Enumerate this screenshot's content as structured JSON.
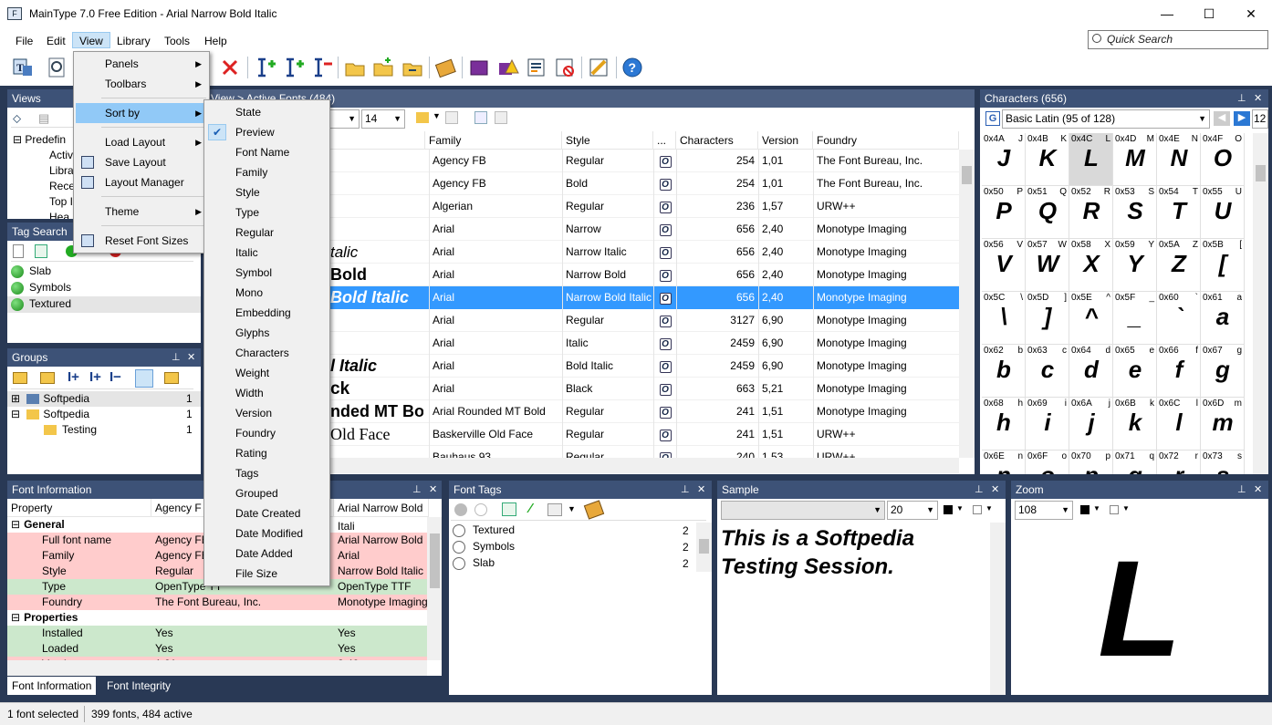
{
  "window": {
    "title": "MainType 7.0 Free Edition - Arial Narrow Bold Italic",
    "minimize": "—",
    "maximize": "☐",
    "close": "✕"
  },
  "menubar": {
    "items": [
      "File",
      "Edit",
      "View",
      "Library",
      "Tools",
      "Help"
    ],
    "active": "View"
  },
  "quick_search": {
    "placeholder": "Quick Search"
  },
  "toolbar": {
    "icons": [
      "new-library-icon",
      "preview-icon",
      "delete-icon",
      "add-fonts-icon",
      "add-folder-icon",
      "remove-fonts-icon",
      "open-folder-icon",
      "new-folder-icon",
      "folder-import-icon",
      "library-icon",
      "purple-book-icon",
      "warning-icon",
      "report-icon",
      "uninstall-icon",
      "print-icon",
      "help-icon"
    ]
  },
  "view_menu": {
    "items": [
      {
        "label": "Panels",
        "submenu": true
      },
      {
        "label": "Toolbars",
        "submenu": true
      },
      {
        "label": "Sort by",
        "submenu": true,
        "highlighted": true
      },
      {
        "label": "Load Layout",
        "submenu": true
      },
      {
        "label": "Save Layout",
        "icon": "save-icon"
      },
      {
        "label": "Layout Manager",
        "icon": "layout-manager-icon"
      },
      {
        "label": "Theme",
        "submenu": true
      },
      {
        "label": "Reset Font Sizes",
        "icon": "reset-font-sizes-icon"
      }
    ]
  },
  "sort_menu": {
    "items": [
      "State",
      "Preview",
      "Font Name",
      "Family",
      "Style",
      "Type",
      "Regular",
      "Italic",
      "Symbol",
      "Mono",
      "Embedding",
      "Glyphs",
      "Characters",
      "Weight",
      "Width",
      "Version",
      "Foundry",
      "Rating",
      "Tags",
      "Grouped",
      "Date Created",
      "Date Modified",
      "Date Added",
      "File Size"
    ],
    "checked": "Preview"
  },
  "views_panel": {
    "title": "Views",
    "tree": [
      "Predefin",
      "Activ",
      "Libra",
      "Rece",
      "Top I",
      "Hea"
    ]
  },
  "tag_search_panel": {
    "title": "Tag Search",
    "items": [
      "Slab",
      "Symbols",
      "Textured"
    ]
  },
  "groups_panel": {
    "title": "Groups",
    "items": [
      {
        "label": "Softpedia",
        "count": "1"
      },
      {
        "label": "Softpedia",
        "count": "1"
      },
      {
        "label": "Testing",
        "count": "1"
      }
    ]
  },
  "font_list": {
    "header": "View > Active Fonts (484)",
    "size": "14",
    "columns": [
      "Family",
      "Style",
      "...",
      "Characters",
      "Version",
      "Foundry"
    ],
    "rows": [
      {
        "preview": "",
        "family": "Agency FB",
        "style": "Regular",
        "chars": "254",
        "version": "1,01",
        "foundry": "The Font Bureau, Inc."
      },
      {
        "preview": "",
        "family": "Agency FB",
        "style": "Bold",
        "chars": "254",
        "version": "1,01",
        "foundry": "The Font Bureau, Inc."
      },
      {
        "preview": "",
        "family": "Algerian",
        "style": "Regular",
        "chars": "236",
        "version": "1,57",
        "foundry": "URW++"
      },
      {
        "preview": "",
        "family": "Arial",
        "style": "Narrow",
        "chars": "656",
        "version": "2,40",
        "foundry": "Monotype Imaging"
      },
      {
        "preview": "talic",
        "family": "Arial",
        "style": "Narrow Italic",
        "chars": "656",
        "version": "2,40",
        "foundry": "Monotype Imaging"
      },
      {
        "preview": "Bold",
        "family": "Arial",
        "style": "Narrow Bold",
        "chars": "656",
        "version": "2,40",
        "foundry": "Monotype Imaging"
      },
      {
        "preview": "Bold Italic",
        "family": "Arial",
        "style": "Narrow Bold Italic",
        "chars": "656",
        "version": "2,40",
        "foundry": "Monotype Imaging",
        "selected": true
      },
      {
        "preview": "",
        "family": "Arial",
        "style": "Regular",
        "chars": "3127",
        "version": "6,90",
        "foundry": "Monotype Imaging"
      },
      {
        "preview": "",
        "family": "Arial",
        "style": "Italic",
        "chars": "2459",
        "version": "6,90",
        "foundry": "Monotype Imaging"
      },
      {
        "preview": "l Italic",
        "family": "Arial",
        "style": "Bold Italic",
        "chars": "2459",
        "version": "6,90",
        "foundry": "Monotype Imaging"
      },
      {
        "preview": "ck",
        "family": "Arial",
        "style": "Black",
        "chars": "663",
        "version": "5,21",
        "foundry": "Monotype Imaging"
      },
      {
        "preview": "nded MT Bo",
        "family": "Arial Rounded MT Bold",
        "style": "Regular",
        "chars": "241",
        "version": "1,51",
        "foundry": "Monotype Imaging"
      },
      {
        "preview": "Old Face",
        "family": "Baskerville Old Face",
        "style": "Regular",
        "chars": "241",
        "version": "1,51",
        "foundry": "URW++"
      },
      {
        "preview": "",
        "family": "Bauhaus 93",
        "style": "Regular",
        "chars": "240",
        "version": "1,53",
        "foundry": "URW++"
      }
    ]
  },
  "characters_panel": {
    "title": "Characters (656)",
    "range": "Basic Latin (95 of 128)",
    "zoom": "12",
    "cells": [
      [
        "0x4A",
        "J"
      ],
      [
        "0x4B",
        "K"
      ],
      [
        "0x4C",
        "L"
      ],
      [
        "0x4D",
        "M"
      ],
      [
        "0x4E",
        "N"
      ],
      [
        "0x4F",
        "O"
      ],
      [
        "0x50",
        "P"
      ],
      [
        "0x51",
        "Q"
      ],
      [
        "0x52",
        "R"
      ],
      [
        "0x53",
        "S"
      ],
      [
        "0x54",
        "T"
      ],
      [
        "0x55",
        "U"
      ],
      [
        "0x56",
        "V"
      ],
      [
        "0x57",
        "W"
      ],
      [
        "0x58",
        "X"
      ],
      [
        "0x59",
        "Y"
      ],
      [
        "0x5A",
        "Z"
      ],
      [
        "0x5B",
        "["
      ],
      [
        "0x5C",
        "\\"
      ],
      [
        "0x5D",
        "]"
      ],
      [
        "0x5E",
        "^"
      ],
      [
        "0x5F",
        "_"
      ],
      [
        "0x60",
        "`"
      ],
      [
        "0x61",
        "a"
      ],
      [
        "0x62",
        "b"
      ],
      [
        "0x63",
        "c"
      ],
      [
        "0x64",
        "d"
      ],
      [
        "0x65",
        "e"
      ],
      [
        "0x66",
        "f"
      ],
      [
        "0x67",
        "g"
      ],
      [
        "0x68",
        "h"
      ],
      [
        "0x69",
        "i"
      ],
      [
        "0x6A",
        "j"
      ],
      [
        "0x6B",
        "k"
      ],
      [
        "0x6C",
        "l"
      ],
      [
        "0x6D",
        "m"
      ],
      [
        "0x6E",
        "n"
      ],
      [
        "0x6F",
        "o"
      ],
      [
        "0x70",
        "p"
      ],
      [
        "0x71",
        "q"
      ],
      [
        "0x72",
        "r"
      ],
      [
        "0x73",
        "s"
      ]
    ],
    "selected_code": "0x4C"
  },
  "font_info_panel": {
    "title": "Font Information",
    "col_property": "Property",
    "col_a": "Agency F",
    "col_b": "Arial Narrow Bold Itali",
    "sections": [
      {
        "label": "General",
        "rows": [
          {
            "prop": "Full font name",
            "a": "Agency FB",
            "b": "Arial Narrow Bold",
            "color": "red"
          },
          {
            "prop": "Family",
            "a": "Agency FB",
            "b": "Arial",
            "color": "red"
          },
          {
            "prop": "Style",
            "a": "Regular",
            "b": "Narrow Bold Italic",
            "color": "red"
          },
          {
            "prop": "Type",
            "a": "OpenType TT",
            "b": "OpenType TTF",
            "color": "green"
          },
          {
            "prop": "Foundry",
            "a": "The Font Bureau, Inc.",
            "b": "Monotype Imaging",
            "color": "red"
          }
        ]
      },
      {
        "label": "Properties",
        "rows": [
          {
            "prop": "Installed",
            "a": "Yes",
            "b": "Yes",
            "color": "green"
          },
          {
            "prop": "Loaded",
            "a": "Yes",
            "b": "Yes",
            "color": "green"
          },
          {
            "prop": "Version",
            "a": "1,01",
            "b": "2,40",
            "color": "red"
          }
        ]
      }
    ],
    "tabs": [
      "Font Information",
      "Font Integrity"
    ]
  },
  "font_tags_panel": {
    "title": "Font Tags",
    "items": [
      {
        "label": "Textured",
        "count": "2"
      },
      {
        "label": "Symbols",
        "count": "2"
      },
      {
        "label": "Slab",
        "count": "2"
      }
    ]
  },
  "sample_panel": {
    "title": "Sample",
    "size": "20",
    "text": "This is a Softpedia Testing Session."
  },
  "zoom_panel": {
    "title": "Zoom",
    "size": "108",
    "glyph": "L"
  },
  "statusbar": {
    "selected": "1 font selected",
    "summary": "399 fonts, 484 active"
  },
  "colors": {
    "panel_header": "#3d5277",
    "workspace": "#293955",
    "selection": "#3399ff",
    "row_red": "#ffcccc",
    "row_green": "#cce8cc"
  }
}
